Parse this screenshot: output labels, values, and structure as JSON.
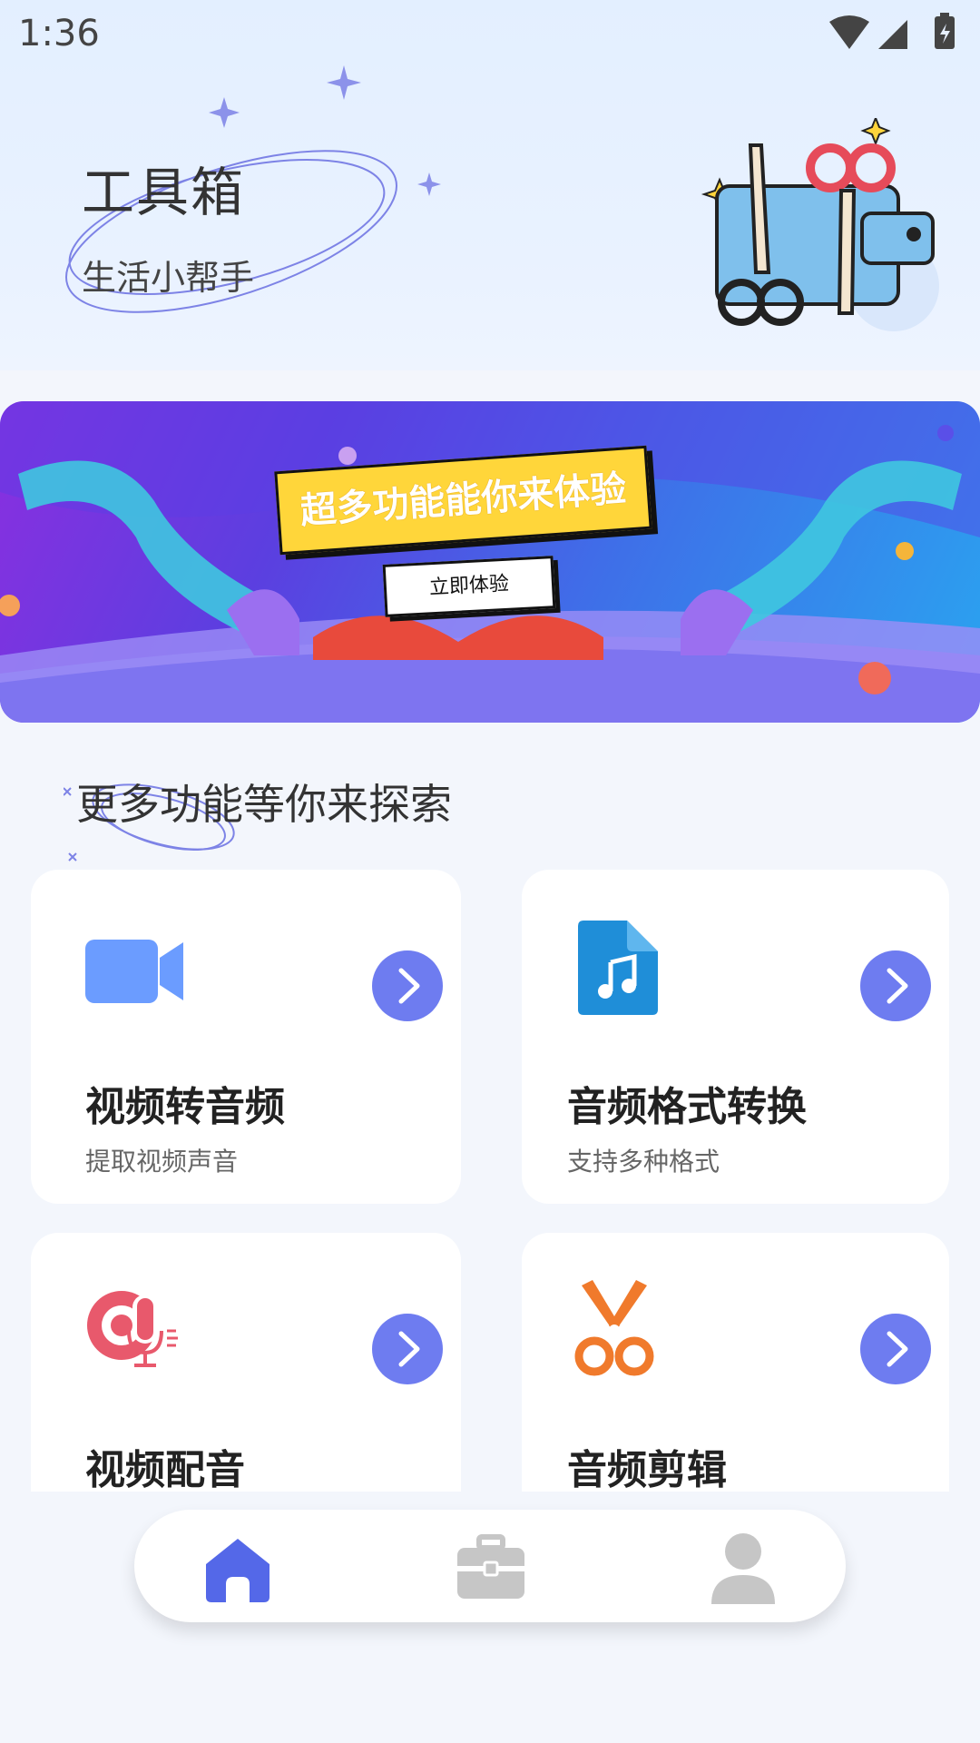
{
  "status_bar": {
    "time": "1:36"
  },
  "header": {
    "title": "工具箱",
    "subtitle": "生活小帮手"
  },
  "banner": {
    "headline": "超多功能能你来体验",
    "button_label": "立即体验"
  },
  "section": {
    "title": "更多功能等你来探索"
  },
  "features": [
    {
      "title": "视频转音频",
      "subtitle": "提取视频声音",
      "icon": "video-camera-icon",
      "color": "#6b9cff"
    },
    {
      "title": "音频格式转换",
      "subtitle": "支持多种格式",
      "icon": "music-file-icon",
      "color": "#1f8ed8"
    },
    {
      "title": "视频配音",
      "subtitle": "",
      "icon": "microphone-icon",
      "color": "#e8596c"
    },
    {
      "title": "音频剪辑",
      "subtitle": "",
      "icon": "scissors-icon",
      "color": "#f07a2c"
    }
  ],
  "bottom_nav": [
    {
      "icon": "home-icon",
      "active": true
    },
    {
      "icon": "toolbox-icon",
      "active": false
    },
    {
      "icon": "profile-icon",
      "active": false
    }
  ],
  "colors": {
    "accent": "#5468e8",
    "arrow": "#6e7cf0",
    "inactive_nav": "#c6c6c6"
  }
}
